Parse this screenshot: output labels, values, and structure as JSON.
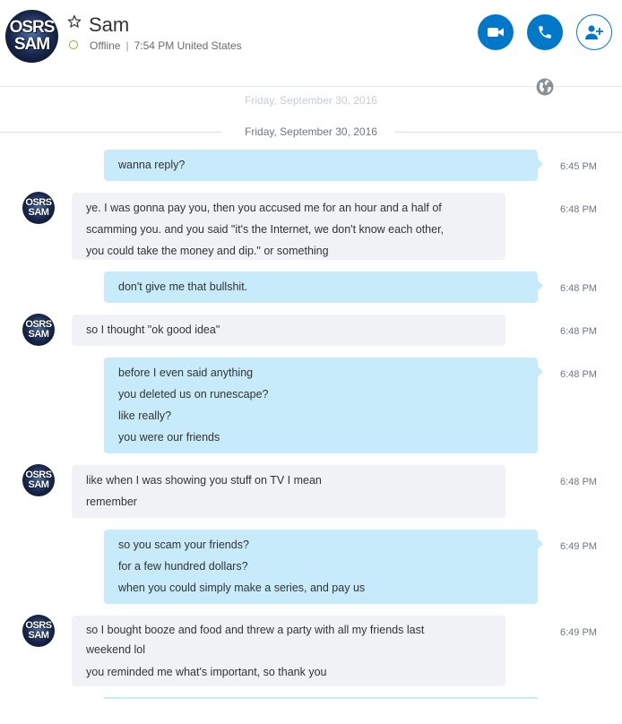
{
  "header": {
    "avatar_text": [
      "OSRS",
      "SAM"
    ],
    "contact_name": "Sam",
    "status": "Offline",
    "local_time": "7:54 PM United States",
    "buttons": {
      "video": "video-call",
      "call": "audio-call",
      "add": "add-participant"
    }
  },
  "conversation": {
    "previous_date": "Friday, September 30, 2016",
    "date_divider": "Friday, September 30, 2016",
    "messages": [
      {
        "direction": "out",
        "lines": [
          "wanna reply?"
        ],
        "time": "6:45 PM"
      },
      {
        "direction": "in",
        "lines": [
          "ye. I was gonna pay you, then you accused me for an hour and a half of",
          "scamming you. and you said \"it's the Internet, we don't know each other,",
          "you could take the money and dip.\" or something"
        ],
        "time": "6:48 PM"
      },
      {
        "direction": "out",
        "lines": [
          "don't give me that bullshit."
        ],
        "time": "6:48 PM"
      },
      {
        "direction": "in",
        "lines": [
          "so I thought \"ok good idea\""
        ],
        "time": "6:48 PM"
      },
      {
        "direction": "out",
        "lines": [
          "before I even said anything",
          "you deleted us on runescape?",
          "like really?",
          "you were our friends"
        ],
        "time": "6:48 PM"
      },
      {
        "direction": "in",
        "lines": [
          "like when I was showing you stuff on TV I mean",
          "remember"
        ],
        "time": "6:48 PM"
      },
      {
        "direction": "out",
        "lines": [
          "so you scam your friends?",
          "for a few hundred dollars?",
          "when you could simply make a series, and pay us"
        ],
        "time": "6:49 PM"
      },
      {
        "direction": "in",
        "lines": [
          "so I bought booze and food and threw a party with all my friends last",
          "weekend lol",
          "you reminded me what's important, so thank you"
        ],
        "time": "6:49 PM"
      }
    ]
  },
  "colors": {
    "accent": "#0078ca",
    "outgoing_bubble": "#c7ebfb",
    "incoming_bubble": "#f0f2f5",
    "status_offline": "#8ab32f"
  }
}
